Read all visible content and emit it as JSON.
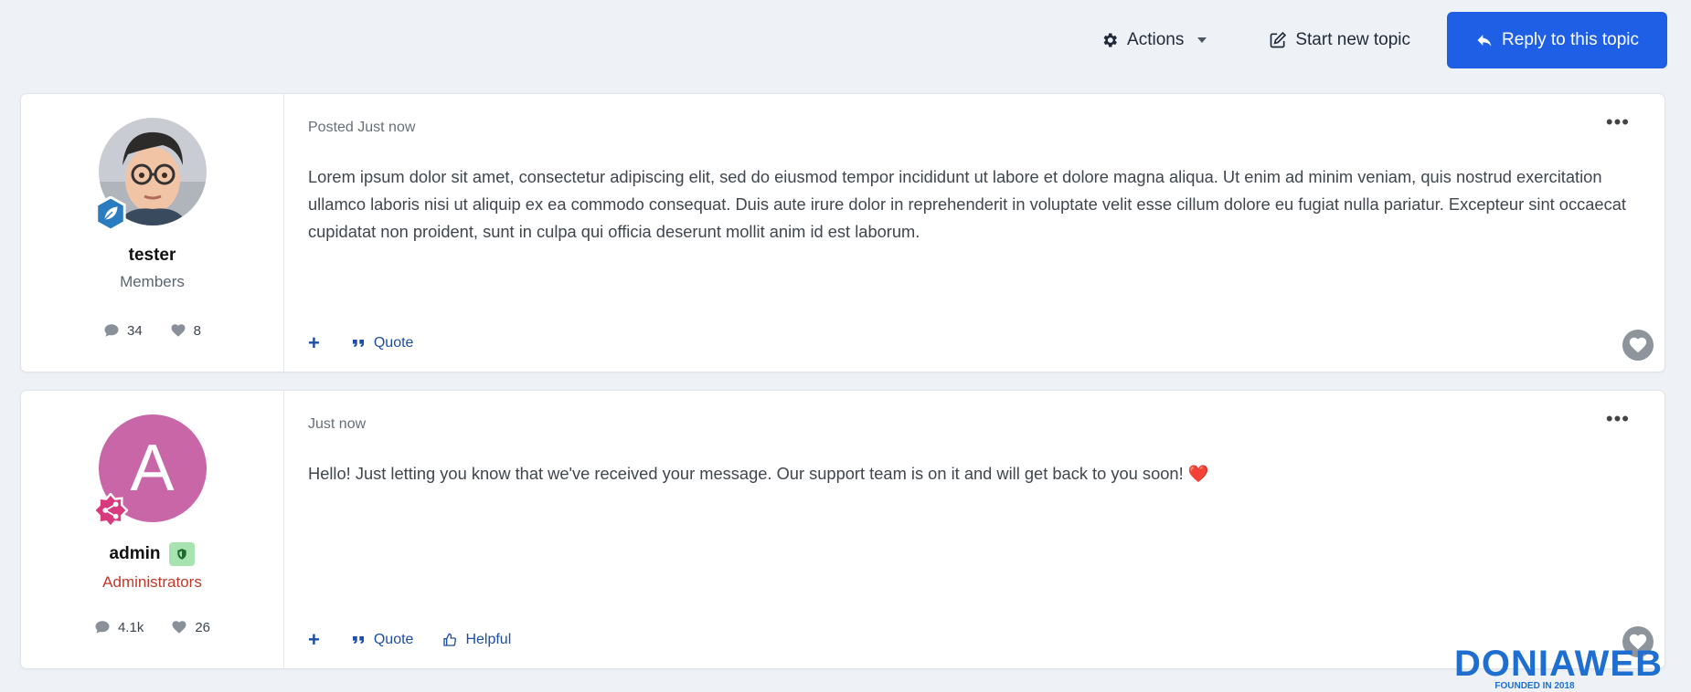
{
  "topbar": {
    "actions_label": "Actions",
    "start_topic_label": "Start new topic",
    "reply_label": "Reply to this topic"
  },
  "posts": [
    {
      "author": {
        "name": "tester",
        "group": "Members",
        "posts_count": "34",
        "likes_count": "8",
        "rank_icon": "leaf-badge-icon"
      },
      "meta": "Posted Just now",
      "body": "Lorem ipsum dolor sit amet, consectetur adipiscing elit, sed do eiusmod tempor incididunt ut labore et dolore magna aliqua. Ut enim ad minim veniam, quis nostrud exercitation ullamco laboris nisi ut aliquip ex ea commodo consequat. Duis aute irure dolor in reprehenderit in voluptate velit esse cillum dolore eu fugiat nulla pariatur. Excepteur sint occaecat cupidatat non proident, sunt in culpa qui officia deserunt mollit anim id est laborum.",
      "controls": {
        "plus": "+",
        "quote": "Quote"
      }
    },
    {
      "author": {
        "name": "admin",
        "avatar_letter": "A",
        "group": "Administrators",
        "posts_count": "4.1k",
        "likes_count": "26",
        "rank_icon": "share-badge-icon"
      },
      "meta": "Just now",
      "body": "Hello! Just letting you know that we've received your message. Our support team is on it and will get back to you soon!",
      "body_emoji": "❤️",
      "controls": {
        "plus": "+",
        "quote": "Quote",
        "helpful": "Helpful"
      }
    }
  ],
  "watermark": {
    "brand": "DONIAWEB",
    "tagline": "FOUNDED IN 2018"
  },
  "colors": {
    "primary": "#1f5fe6",
    "link": "#1d4ea3",
    "admin_group": "#c0392b",
    "avatar_admin": "#c966a8"
  }
}
